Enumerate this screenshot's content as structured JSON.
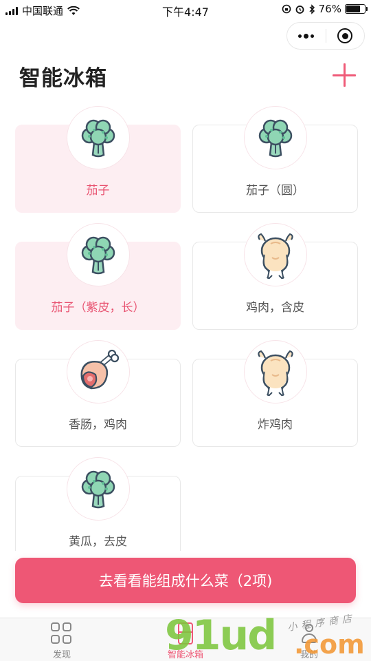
{
  "status_bar": {
    "carrier": "中国联通",
    "time": "下午4:47",
    "battery_percent": "76%",
    "battery_level": 0.76
  },
  "header": {
    "title": "智能冰箱"
  },
  "items": [
    {
      "label": "茄子",
      "selected": true,
      "icon": "broccoli-icon"
    },
    {
      "label": "茄子（圆）",
      "selected": false,
      "icon": "broccoli-icon"
    },
    {
      "label": "茄子（紫皮，长）",
      "selected": true,
      "icon": "broccoli-icon"
    },
    {
      "label": "鸡肉，含皮",
      "selected": false,
      "icon": "roast-chicken-icon"
    },
    {
      "label": "香肠，鸡肉",
      "selected": false,
      "icon": "ham-leg-icon"
    },
    {
      "label": "炸鸡肉",
      "selected": false,
      "icon": "roast-chicken-icon"
    },
    {
      "label": "黄瓜，去皮",
      "selected": false,
      "icon": "broccoli-icon"
    }
  ],
  "cta": {
    "label": "去看看能组成什么菜（2项)"
  },
  "tabbar": {
    "tabs": [
      {
        "label": "发现",
        "icon": "grid-icon",
        "active": false
      },
      {
        "label": "智能冰箱",
        "icon": "fridge-icon",
        "active": true
      },
      {
        "label": "我的",
        "icon": "user-icon",
        "active": false
      }
    ]
  },
  "watermark": {
    "main": "91ud",
    "suffix": ".com",
    "sub": "小程序商店"
  },
  "colors": {
    "accent": "#ee5775",
    "selected_bg": "#fdeef2",
    "broccoli": "#8fd6b4"
  }
}
